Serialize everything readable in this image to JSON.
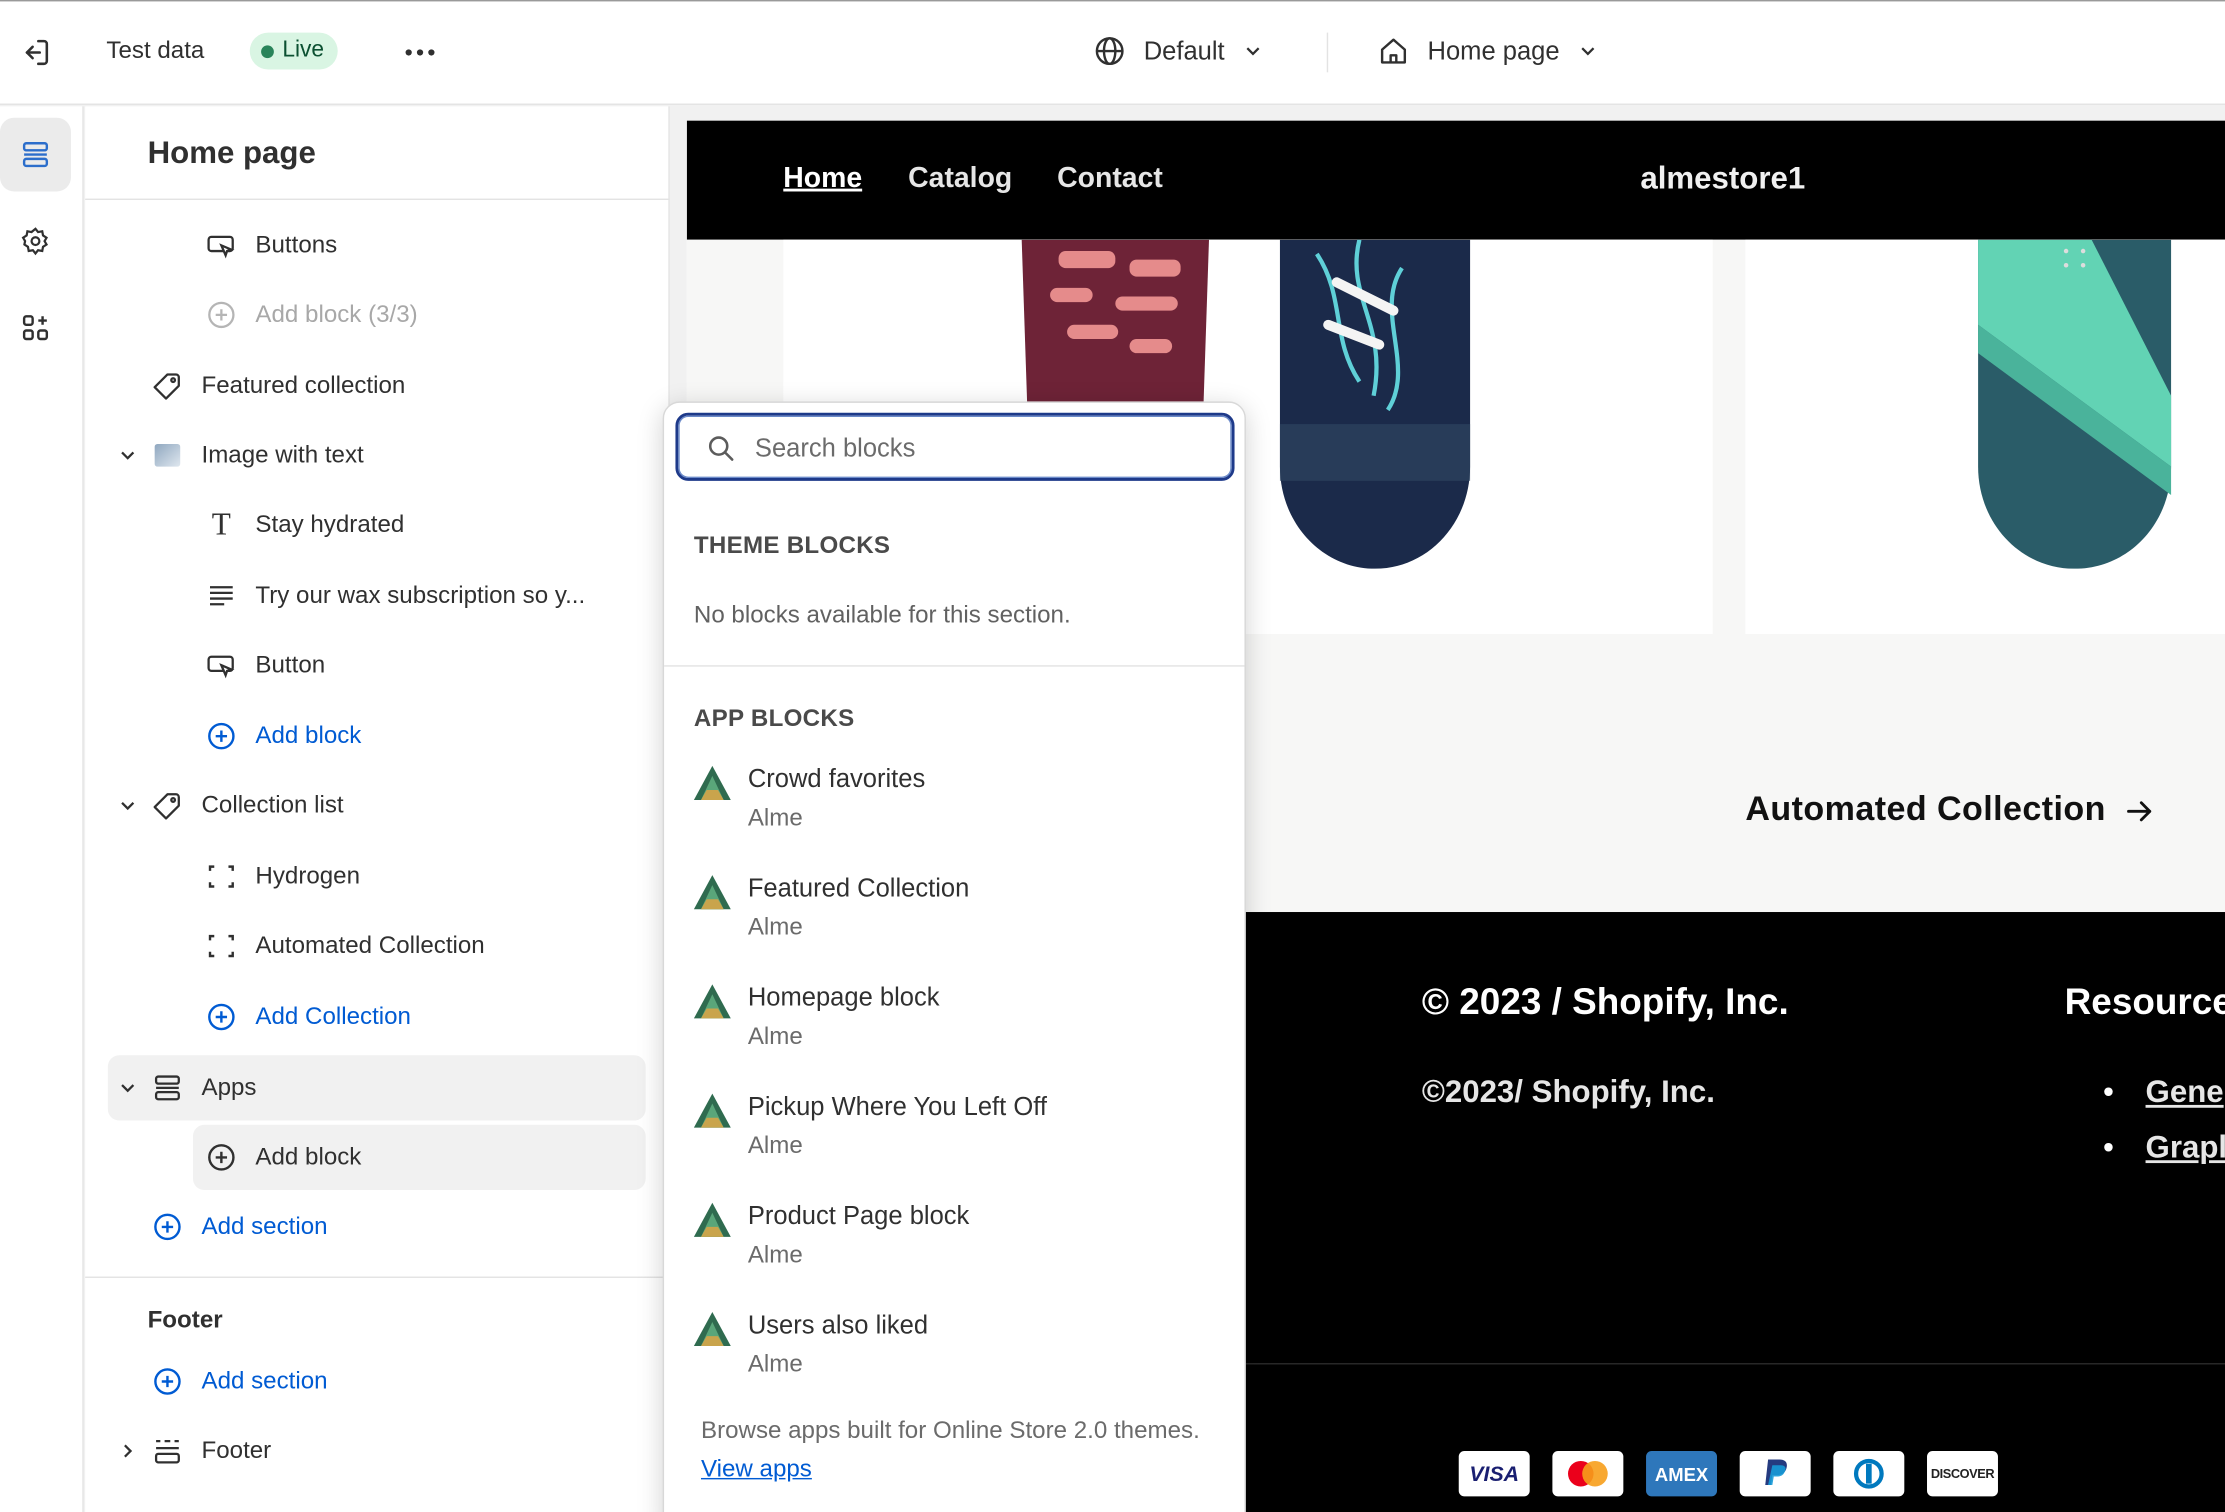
{
  "topbar": {
    "store_name": "Test data",
    "status_badge": "Live",
    "more_icon": "ellipsis-icon",
    "market_label": "Default",
    "page_label": "Home page"
  },
  "rail": {
    "items": [
      "sections-icon",
      "settings-icon",
      "apps-icon"
    ]
  },
  "panel": {
    "title": "Home page",
    "tree": [
      {
        "label": "Buttons",
        "icon": "button-icon"
      },
      {
        "label": "Add block (3/3)",
        "icon": "plus-circle-icon",
        "disabled": true
      },
      {
        "label": "Featured collection",
        "icon": "tag-icon"
      },
      {
        "label": "Image with text",
        "icon": "image-icon"
      },
      {
        "label": "Stay hydrated",
        "icon": "text-icon"
      },
      {
        "label": "Try our wax subscription so y...",
        "icon": "paragraph-icon"
      },
      {
        "label": "Button",
        "icon": "button-icon"
      },
      {
        "label": "Add block",
        "icon": "plus-circle-icon"
      },
      {
        "label": "Collection list",
        "icon": "tag-icon"
      },
      {
        "label": "Hydrogen",
        "icon": "collection-icon"
      },
      {
        "label": "Automated Collection",
        "icon": "collection-icon"
      },
      {
        "label": "Add Collection",
        "icon": "plus-circle-icon"
      },
      {
        "label": "Apps",
        "icon": "apps-section-icon"
      },
      {
        "label": "Add block",
        "icon": "plus-circle-icon"
      },
      {
        "label": "Add section",
        "icon": "plus-circle-icon"
      }
    ],
    "footer_group": {
      "heading": "Footer",
      "add_section": "Add section",
      "footer_item": "Footer"
    }
  },
  "popover": {
    "search_placeholder": "Search blocks",
    "theme_heading": "THEME BLOCKS",
    "theme_empty": "No blocks available for this section.",
    "app_heading": "APP BLOCKS",
    "apps": [
      {
        "name": "Crowd favorites",
        "vendor": "Alme"
      },
      {
        "name": "Featured Collection",
        "vendor": "Alme"
      },
      {
        "name": "Homepage block",
        "vendor": "Alme"
      },
      {
        "name": "Pickup Where You Left Off",
        "vendor": "Alme"
      },
      {
        "name": "Product Page block",
        "vendor": "Alme"
      },
      {
        "name": "Users also liked",
        "vendor": "Alme"
      }
    ],
    "browse_text": "Browse apps built for Online Store 2.0 themes.",
    "view_apps": "View apps"
  },
  "preview": {
    "nav": [
      "Home",
      "Catalog",
      "Contact"
    ],
    "brand": "almestore1",
    "collection_title": "Automated Collection",
    "footer_copyright": "© 2023 / Shopify, Inc.",
    "footer_copyright2": "©2023/ Shopify, Inc.",
    "footer_resources": "Resource",
    "footer_links": [
      "Gene",
      "Grapl"
    ],
    "payment_methods": [
      "VISA",
      "mastercard",
      "AMEX",
      "PayPal",
      "Diners",
      "DISCOVER"
    ]
  },
  "colors": {
    "accent_blue": "#005bd3",
    "live_green": "#29845a",
    "preview_black": "#000000"
  }
}
